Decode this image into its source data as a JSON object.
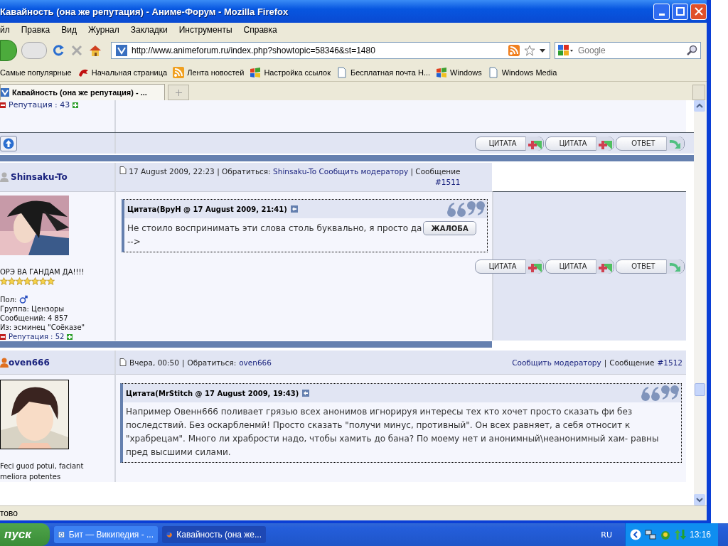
{
  "window": {
    "title": "Кавайность (она же репутация) - Аниме-Форум - Mozilla Firefox"
  },
  "menu": [
    "йл",
    "Правка",
    "Вид",
    "Журнал",
    "Закладки",
    "Инструменты",
    "Справка"
  ],
  "address": {
    "value": "http://www.animeforum.ru/index.php?showtopic=58346&st=1480"
  },
  "search": {
    "placeholder": "Google"
  },
  "bookmarks": [
    {
      "label": "Самые популярные",
      "kind": "plain"
    },
    {
      "label": "Начальная страница",
      "kind": "bird"
    },
    {
      "label": "Лента новостей",
      "kind": "feed"
    },
    {
      "label": "Настройка ссылок",
      "kind": "windows"
    },
    {
      "label": "Бесплатная почта Н...",
      "kind": "page"
    },
    {
      "label": "Windows",
      "kind": "windows"
    },
    {
      "label": "Windows Media",
      "kind": "page"
    }
  ],
  "tabs": [
    {
      "label": "Кавайность (она же репутация) - ...",
      "selected": true
    }
  ],
  "previous_post": {
    "reputation": "Репутация : 43",
    "buttons": [
      {
        "label": "ЦИТАТА",
        "kind": "quote"
      },
      {
        "label": "ЦИТАТА",
        "kind": "multiquote"
      },
      {
        "label": "ОТВЕТ",
        "kind": "reply"
      }
    ]
  },
  "posts": [
    {
      "author": "Shinsaku-To",
      "online": false,
      "date": "17 August 2009, 22:23",
      "separator": "|",
      "contact_label": "Обратиться:",
      "contact": "Shinsaku-To",
      "report": "Сообщить модератору",
      "number_label": "Сообщение",
      "number": "#1511",
      "title": "ОРЭ ВА ГАНДАМ ДА!!!!",
      "stars": 7,
      "gender_label": "Пол:",
      "details": [
        "Группа: Цензоры",
        "Сообщений: 4 857",
        "Из: эсминец \"Соёказе\""
      ],
      "reputation": "Репутация : 52",
      "quote": {
        "header": "Цитата(ВруН @ 17 August 2009, 21:41)",
        "text": "Не стоило воспринимать эти слова столь буквально, я просто да",
        "after": "-->",
        "complaint": "ЖАЛОБА"
      },
      "buttons": [
        {
          "label": "ЦИТАТА",
          "kind": "quote"
        },
        {
          "label": "ЦИТАТА",
          "kind": "multiquote"
        },
        {
          "label": "ОТВЕТ",
          "kind": "reply"
        }
      ]
    },
    {
      "author": "oven666",
      "online": true,
      "date": "Вчера, 00:50",
      "separator": "|",
      "contact_label": "Обратиться:",
      "contact": "oven666",
      "report": "Сообщить модератору",
      "number_label": "Сообщение",
      "number": "#1512",
      "signature": "Feci guod potui, faciant meliora potentes",
      "quote": {
        "header": "Цитата(MrStitch @ 17 August 2009, 19:43)",
        "text": "Например Овенн666 поливает грязью всех анонимов игнорируя интересы тех кто хочет просто сказать фи без последствий. Без оскарбленмй! Просто сказать \"получи минус, противный\". Он всех равняет, а себя относит к \"храбрецам\". Много ли храбрости надо, чтобы хамить до бана? По моему нет и анонимный\\неанонимный хам- равны пред высшими силами."
      }
    }
  ],
  "status": "тово",
  "taskbar": {
    "start": "пуск",
    "tasks": [
      {
        "label": "Бит — Википедия - ...",
        "kind": "ie",
        "selected": false
      },
      {
        "label": "Кавайность (она же...",
        "kind": "firefox",
        "selected": true
      }
    ],
    "language": "RU",
    "clock": "13:16"
  }
}
